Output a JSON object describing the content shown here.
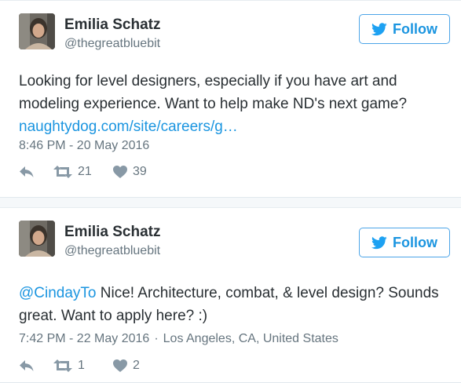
{
  "colors": {
    "link": "#1b95e0",
    "name": "#292f33",
    "secondary": "#66757f",
    "icon": "#8899a6",
    "follow_border": "#4ca5e8"
  },
  "tweets": [
    {
      "author": {
        "name": "Emilia Schatz",
        "handle": "@thegreatbluebit",
        "avatar_icon": "avatar-photo"
      },
      "follow_label": "Follow",
      "text": "Looking for level designers, especially if you have art and modeling experience. Want to help make ND's next game?",
      "link": "naughtydog.com/site/careers/g…",
      "timestamp": "8:46 PM - 20 May 2016",
      "location": "",
      "actions": {
        "reply_icon": "reply-icon",
        "retweet_icon": "retweet-icon",
        "retweet_count": "21",
        "like_icon": "heart-icon",
        "like_count": "39"
      }
    },
    {
      "author": {
        "name": "Emilia Schatz",
        "handle": "@thegreatbluebit",
        "avatar_icon": "avatar-photo"
      },
      "follow_label": "Follow",
      "mention": "@CindayTo",
      "text": " Nice! Architecture, combat, & level design? Sounds great. Want to apply here? :)",
      "timestamp": "7:42 PM - 22 May 2016",
      "separator": "·",
      "location": "Los Angeles, CA, United States",
      "actions": {
        "reply_icon": "reply-icon",
        "retweet_icon": "retweet-icon",
        "retweet_count": "1",
        "like_icon": "heart-icon",
        "like_count": "2"
      }
    }
  ]
}
